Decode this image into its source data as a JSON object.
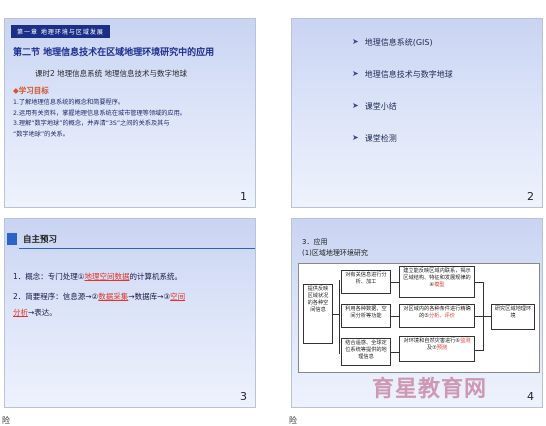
{
  "slides": [
    {
      "number": "1",
      "chapter_tag": "第一章  地理环境与区域发展",
      "section_title": "第二节  地理信息技术在区域地理环境研究中的应用",
      "lesson": "课时2  地理信息系统  地理信息技术与数字地球",
      "goals_title": "◆学习目标",
      "goals": [
        "1.了解地理信息系统的概念和简要程序。",
        "2.运用有关资料，掌握地理信息系统在城市管理等领域的应用。",
        "3.理解“数字地球”的概念，并弄清“3S”之间的关系及其与",
        "   “数字地球”的关系。"
      ]
    },
    {
      "number": "2",
      "items": [
        "地理信息系统(GIS)",
        "地理信息技术与数字地球",
        "课堂小结",
        "课堂检测"
      ]
    },
    {
      "number": "3",
      "title": "自主预习",
      "line1_pre": "1．概念：专门处理①",
      "line1_blank": "地理空间数据",
      "line1_post": "的计算机系统。",
      "line2_pre": "2．简要程序：信息源→②",
      "line2_blank1": "数据采集",
      "line2_mid": "→数据库→③",
      "line2_blank2": "空间",
      "line3_blank": "分析",
      "line3_post": "→表达。",
      "corner": "险"
    },
    {
      "number": "4",
      "heading": "3．应用",
      "subheading": "(1)区域地理环境研究",
      "diagram": {
        "left": "提供反映区域状况的各种空间信息",
        "mid1": "对有关信息进行分析、加工",
        "mid2": "利用各种数据、空间分析等功能",
        "mid3": "结合遥感、全球定位系统等提供的地理信息",
        "right1_pre": "建立能反映区域内联系，揭示区域结构、特征和发展规律的④",
        "right1_blank": "模型",
        "right2_pre": "对区域内的各种条件进行精确的⑤",
        "right2_blank": "分析、评价",
        "right3_pre": "对环境和自然灾害进行⑥",
        "right3_blank": "监测",
        "right3_post": "及⑦",
        "right3_blank2": "预测",
        "final": "研究区域地理环境"
      },
      "watermark": "育星教育网",
      "corner": "险"
    }
  ]
}
